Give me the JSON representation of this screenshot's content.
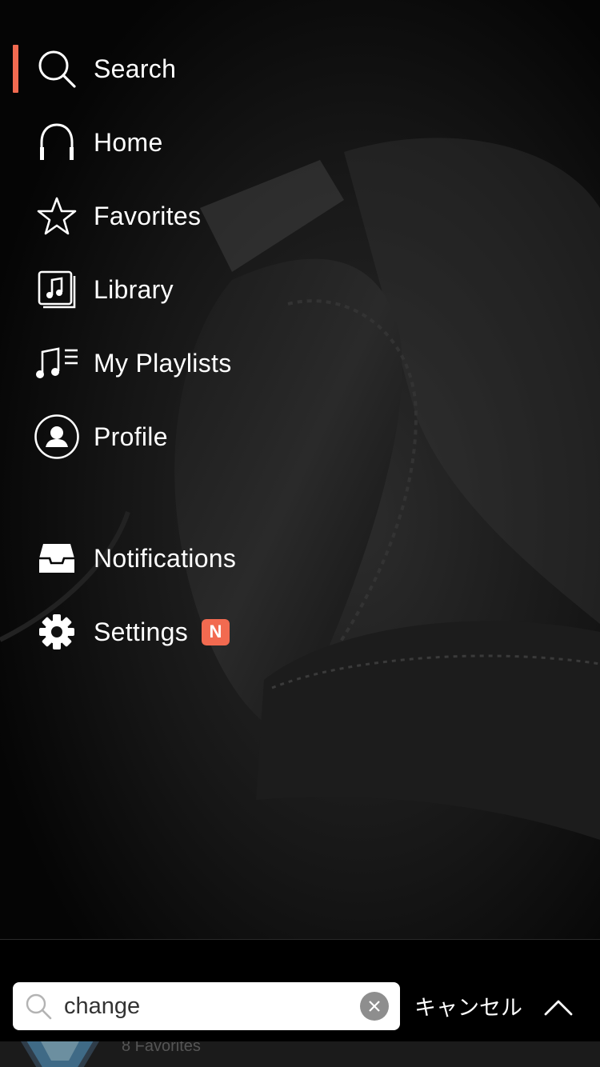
{
  "menu": {
    "items": [
      {
        "label": "Search",
        "icon": "search-icon",
        "active": true
      },
      {
        "label": "Home",
        "icon": "headphones-icon"
      },
      {
        "label": "Favorites",
        "icon": "star-icon"
      },
      {
        "label": "Library",
        "icon": "music-library-icon"
      },
      {
        "label": "My Playlists",
        "icon": "playlist-icon"
      },
      {
        "label": "Profile",
        "icon": "profile-icon"
      },
      {
        "label": "Notifications",
        "icon": "inbox-icon"
      },
      {
        "label": "Settings",
        "icon": "gear-icon",
        "badge": "N"
      }
    ]
  },
  "search": {
    "value": "change",
    "cancel_label": "キャンセル"
  },
  "peek": {
    "text": "8 Favorites"
  },
  "colors": {
    "accent": "#f26a50",
    "background": "#0a0a0a"
  }
}
